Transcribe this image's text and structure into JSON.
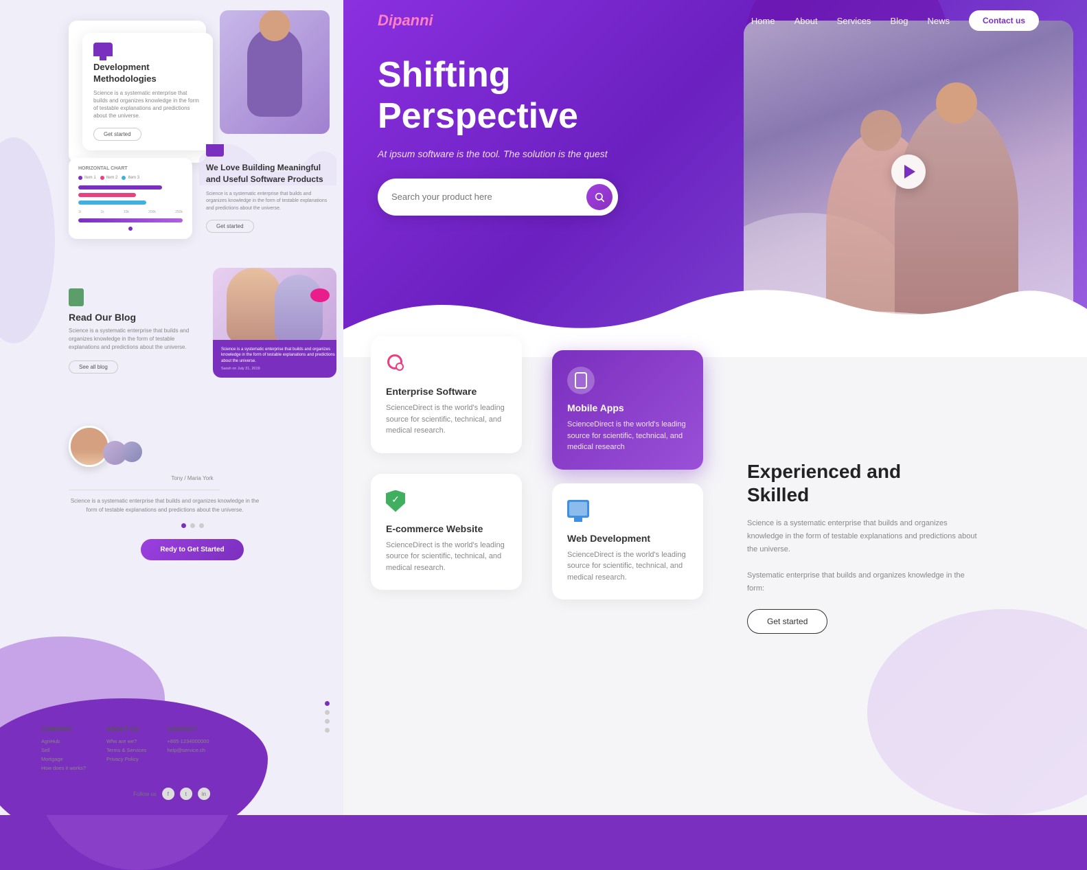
{
  "left_panel": {
    "section_dev": {
      "monitor_label": "💻",
      "title": "Development Methodologies",
      "description": "Science is a systematic enterprise that builds and organizes knowledge in the form of testable explanations and predictions about the universe.",
      "btn_label": "Get started"
    },
    "section_chart": {
      "title": "HORIZONTAL CHART",
      "legend": [
        {
          "color": "#7B2FBE",
          "label": "Item 1"
        },
        {
          "color": "#E94080",
          "label": "Item 2"
        },
        {
          "color": "#40B0E0",
          "label": "Item 3"
        }
      ],
      "bars": [
        {
          "width": "80%",
          "color": "#7B2FBE"
        },
        {
          "width": "55%",
          "color": "#E94080"
        },
        {
          "width": "65%",
          "color": "#40B0E0"
        }
      ],
      "x_labels": [
        "1t",
        "1k",
        "10k",
        "200k",
        "250k"
      ],
      "heading": "We Love Building Meaningful and Useful Software Products",
      "description": "Science is a systematic enterprise that builds and organizes knowledge in the form of testable explanations and predictions about the universe.",
      "btn_label": "Get started"
    },
    "section_blog": {
      "icon_label": "📗",
      "title": "Read Our Blog",
      "description": "Science is a systematic enterprise that builds and organizes knowledge in the form of testable explanations and predictions about the universe.",
      "btn_label": "See all blog",
      "blog_card_text": "Science is a systematic enterprise that builds and organizes knowledge in the form of testable explanations and predictions about the universe.",
      "blog_date": "Sarah on July 31, 2019"
    },
    "section_testimonial": {
      "name": "Tony / Maria York",
      "text": "Science is a systematic enterprise that builds and organizes knowledge in the form of testable explanations and predictions about the universe.",
      "btn_label": "Redy to Get Started"
    },
    "footer": {
      "company": {
        "heading": "COMPANY",
        "links": [
          "AgriHub",
          "Sell",
          "Mortgage",
          "How does it works?"
        ]
      },
      "about": {
        "heading": "ABOUT US",
        "links": [
          "Who are we?",
          "Terms & Services",
          "Privacy Policy"
        ]
      },
      "contact": {
        "heading": "CONTACT",
        "links": [
          "+865-1234000000",
          "help@service.ch"
        ]
      }
    }
  },
  "right_panel": {
    "navbar": {
      "logo": "Dipanni",
      "links": [
        "Home",
        "About",
        "Services",
        "Blog",
        "News"
      ],
      "contact_btn": "Contact us"
    },
    "hero": {
      "headline_line1": "Shifting",
      "headline_line2": "Perspective",
      "subtitle": "At ipsum software is the tool. The solution is the quest",
      "search_placeholder": "Search your product here"
    },
    "services": {
      "enterprise": {
        "title": "Enterprise Software",
        "description": "ScienceDirect is the world's leading source for scientific, technical, and medical research."
      },
      "mobile": {
        "title": "Mobile Apps",
        "description": "ScienceDirect is the world's leading source for scientific, technical, and medical research"
      },
      "ecommerce": {
        "title": "E-commerce Website",
        "description": "ScienceDirect is the world's leading source for scientific, technical, and medical research."
      },
      "webdev": {
        "title": "Web Development",
        "description": "ScienceDirect is the world's leading source for scientific, technical, and medical research."
      }
    },
    "experienced": {
      "title_line1": "Experienced and",
      "title_line2": "Skilled",
      "description1": "Science is a systematic enterprise that builds and organizes knowledge in the form of testable explanations and predictions about the universe.",
      "description2": "Systematic enterprise that builds and organizes knowledge in the form:",
      "btn_label": "Get started"
    }
  }
}
